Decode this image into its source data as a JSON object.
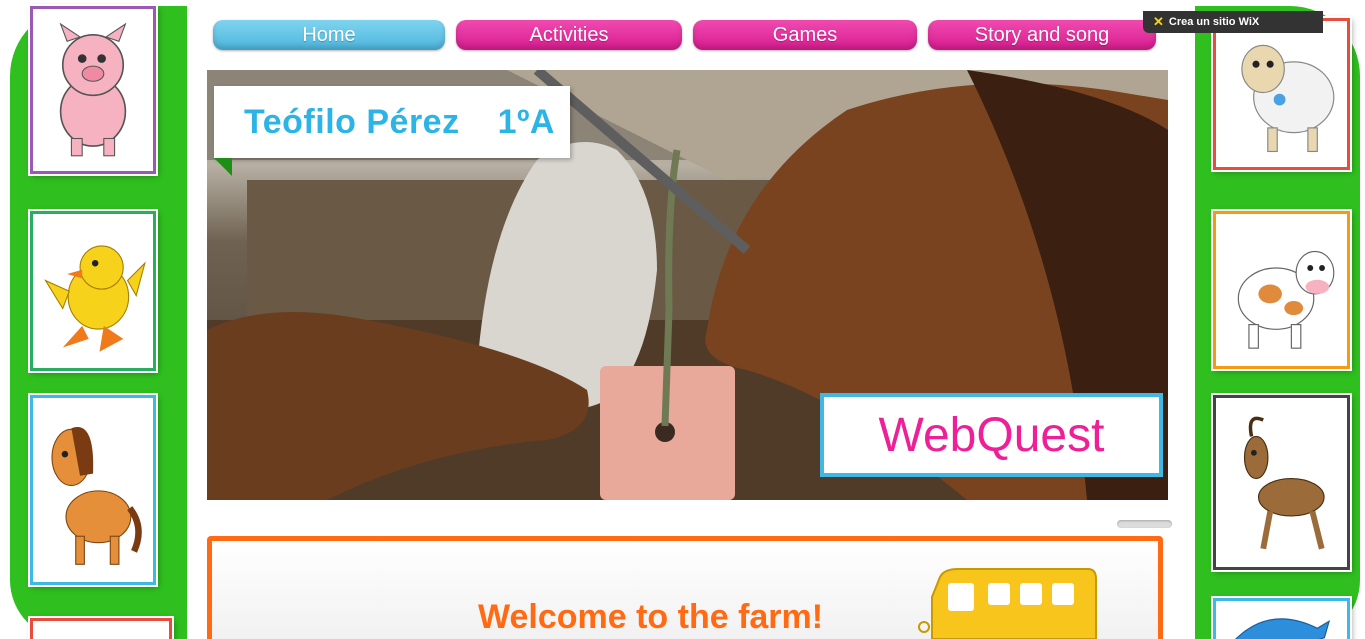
{
  "nav": {
    "items": [
      {
        "label": "Home",
        "active": true
      },
      {
        "label": "Activities",
        "active": false
      },
      {
        "label": "Games",
        "active": false
      },
      {
        "label": "Story and song",
        "active": false
      }
    ]
  },
  "wix": {
    "badge_label": "Crea un sitio WiX"
  },
  "hero": {
    "title": "Teófilo Pérez",
    "class_label": "1ºA",
    "badge": "WebQuest"
  },
  "welcome": {
    "heading": "Welcome to the farm!"
  },
  "animals": {
    "left": [
      "pig",
      "chick",
      "horse"
    ],
    "right": [
      "sheep",
      "cow",
      "goat",
      "dolphin"
    ]
  },
  "colors": {
    "frame_green": "#2fbf1f",
    "nav_home": "#4db6dd",
    "nav_pink": "#e0248f",
    "title_blue": "#2db4e6",
    "webquest_pink": "#ee1f97",
    "welcome_orange": "#ff6a12"
  }
}
